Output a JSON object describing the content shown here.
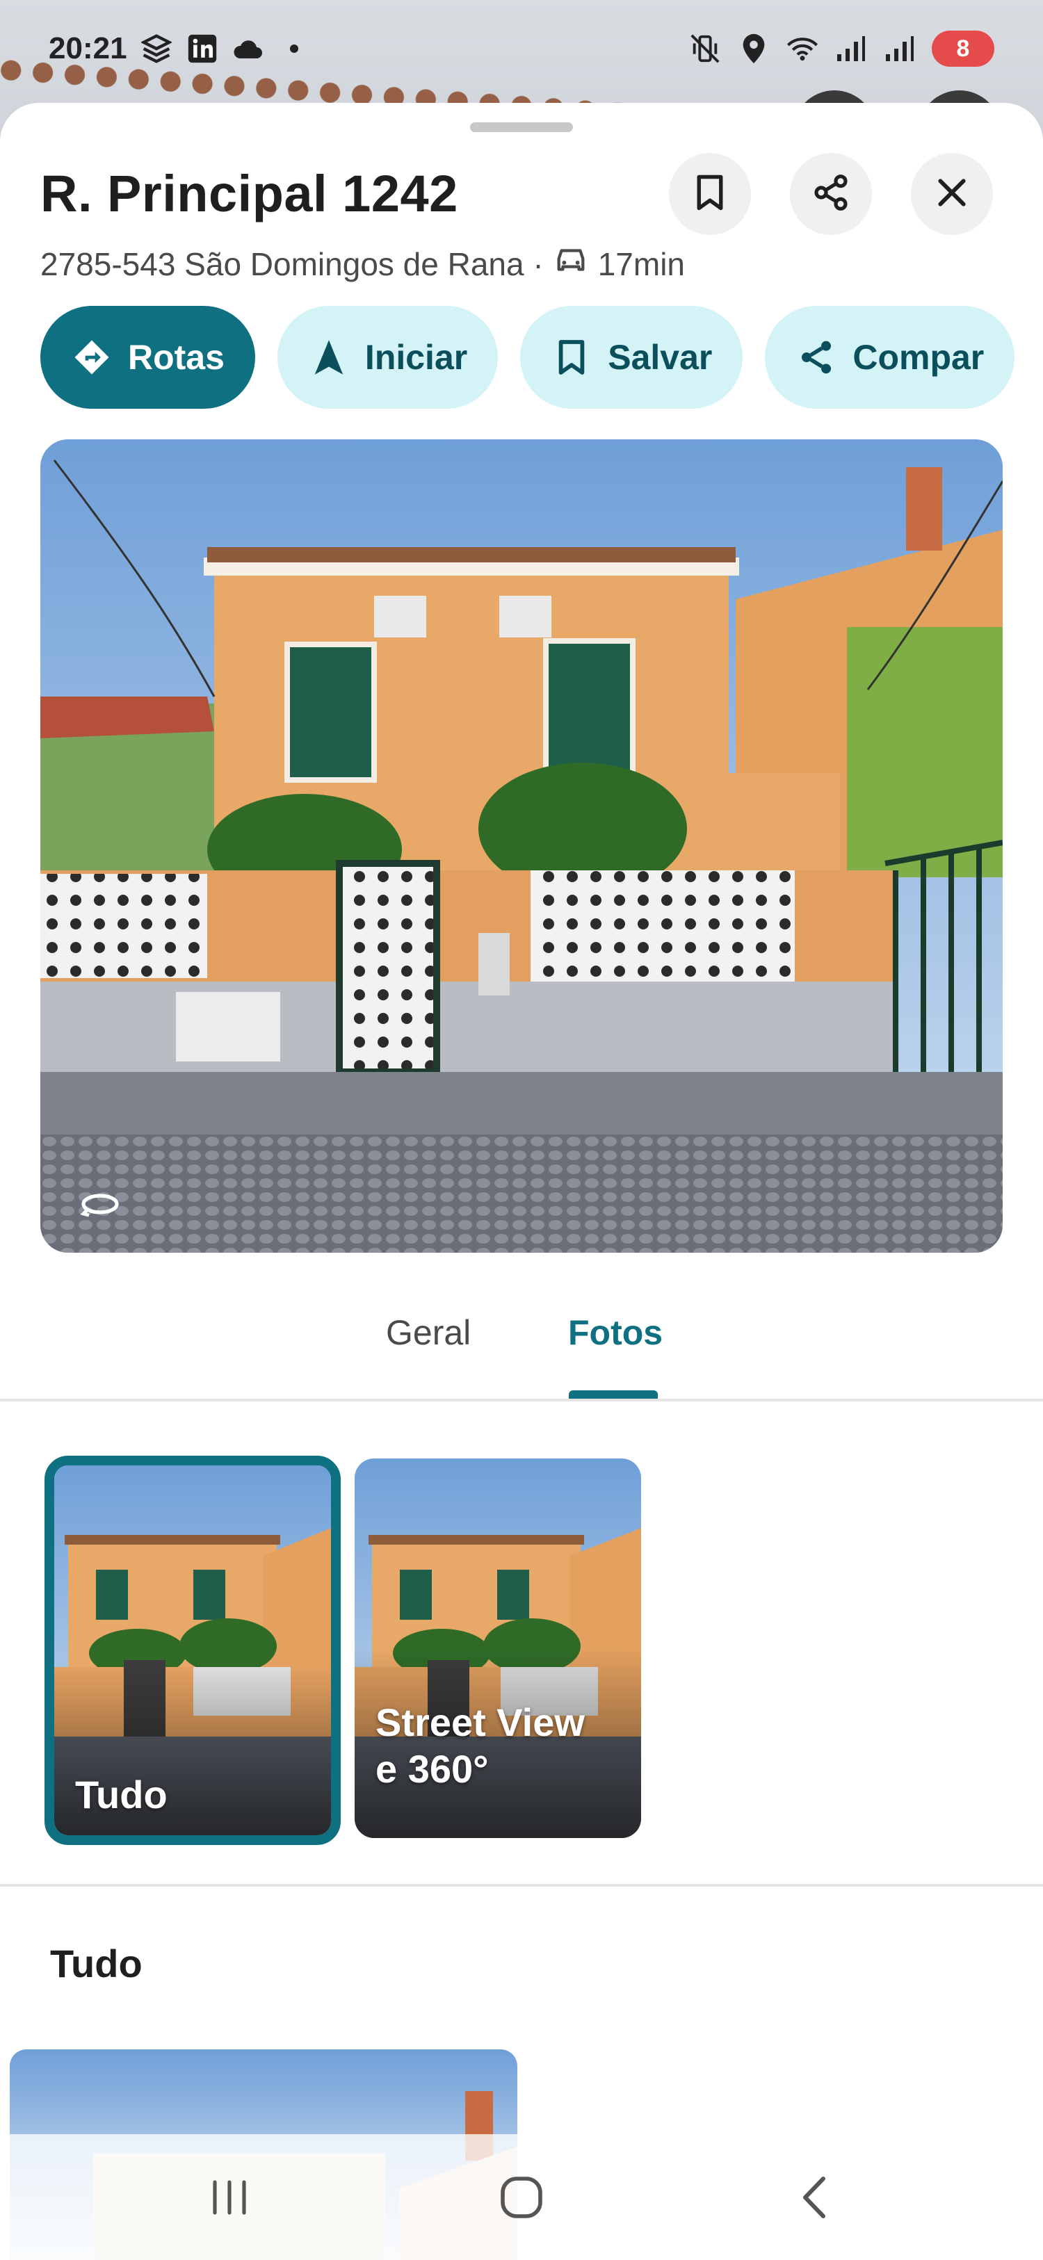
{
  "status_bar": {
    "time": "20:21",
    "battery": "8",
    "left_icons": [
      "stack-app-icon",
      "linkedin-icon",
      "cloud-icon",
      "dot-icon"
    ],
    "right_icons": [
      "vibrate-mute-icon",
      "location-icon",
      "wifi-icon",
      "signal-icon",
      "signal-icon"
    ]
  },
  "place": {
    "title": "R. Principal 1242",
    "address": "2785-543 São Domingos de Rana ·",
    "drive_time": "17min"
  },
  "header_buttons": [
    "bookmark-icon",
    "share-icon",
    "close-icon"
  ],
  "chips": [
    {
      "label": "Rotas",
      "icon": "directions-icon",
      "primary": true
    },
    {
      "label": "Iniciar",
      "icon": "navigation-arrow-icon",
      "primary": false
    },
    {
      "label": "Salvar",
      "icon": "bookmark-icon",
      "primary": false
    },
    {
      "label": "Compar",
      "icon": "share-icon",
      "primary": false
    }
  ],
  "tabs": [
    {
      "label": "Geral",
      "active": false
    },
    {
      "label": "Fotos",
      "active": true
    }
  ],
  "photo_categories": [
    {
      "label": "Tudo",
      "selected": true
    },
    {
      "label": "Street View e 360°",
      "label_line1": "Street View",
      "label_line2": "e 360°",
      "selected": false
    }
  ],
  "section": {
    "title": "Tudo"
  },
  "colors": {
    "accent": "#0e7081",
    "chip_bg": "#d3f3f7",
    "chip_text": "#0b4f5c",
    "battery": "#e54b4b"
  }
}
